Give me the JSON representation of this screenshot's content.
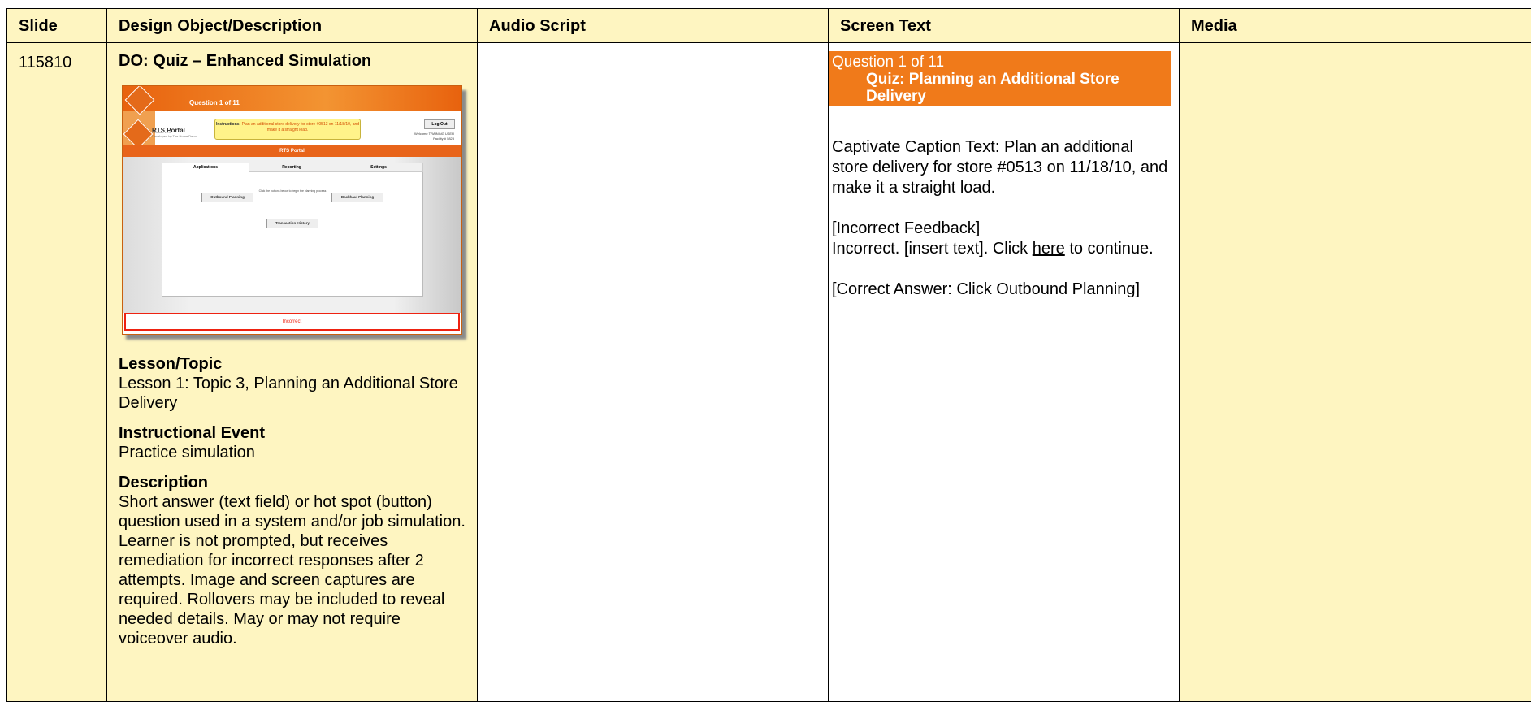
{
  "headers": {
    "slide": "Slide",
    "design": "Design Object/Description",
    "audio": "Audio Script",
    "screen_text": "Screen Text",
    "media": "Media"
  },
  "row": {
    "slide_number": "115810",
    "design_object_title": "DO: Quiz – Enhanced Simulation",
    "thumbnail": {
      "question": "Question 1 of 11",
      "portal_title": "RTS Portal",
      "version_line1": "Release v1.0",
      "version_line2": "Developed by The Home Depot",
      "instructions_label": "Instructions:",
      "instructions_text": "Plan an additional store delivery for store #0513 on 11/18/10, and make it a straight load.",
      "logout": "Log Out",
      "welcome": "Welcome  TRAINING USER",
      "facility": "Facility #  5823",
      "bar_title": "RTS Portal",
      "tabs": [
        "Applications",
        "Reporting",
        "Settings"
      ],
      "hint": "Click the buttons below to begin the planning process",
      "buttons": [
        "Outbound Planning",
        "Backhaul Planning",
        "Transaction History"
      ],
      "feedback": "Incorrect"
    },
    "lesson_topic": {
      "heading": "Lesson/Topic",
      "text": "Lesson 1: Topic 3, Planning an Additional Store Delivery"
    },
    "instructional_event": {
      "heading": "Instructional Event",
      "text": "Practice simulation"
    },
    "description": {
      "heading": "Description",
      "text": "Short answer (text field) or hot spot (button) question used in a system and/or job simulation. Learner is not prompted, but receives remediation for incorrect responses after 2 attempts. Image and screen captures are required. Rollovers may be included to reveal needed details. May or may not require voiceover audio."
    },
    "audio_script": "",
    "screen_text": {
      "banner_line1": "Question 1 of 11",
      "banner_line2": "Quiz: Planning an Additional Store Delivery",
      "caption": "Captivate Caption Text: Plan an additional store delivery for store #0513 on 11/18/10, and make it a straight load.",
      "incorrect_heading": "[Incorrect Feedback]",
      "incorrect_pre": "Incorrect. [insert text]. Click ",
      "incorrect_link": "here",
      "incorrect_post": " to continue.",
      "correct_answer": "[Correct Answer: Click Outbound Planning]"
    },
    "media": ""
  },
  "colors": {
    "cell_yellow": "#fef5c1",
    "banner_orange": "#f07a1a"
  }
}
